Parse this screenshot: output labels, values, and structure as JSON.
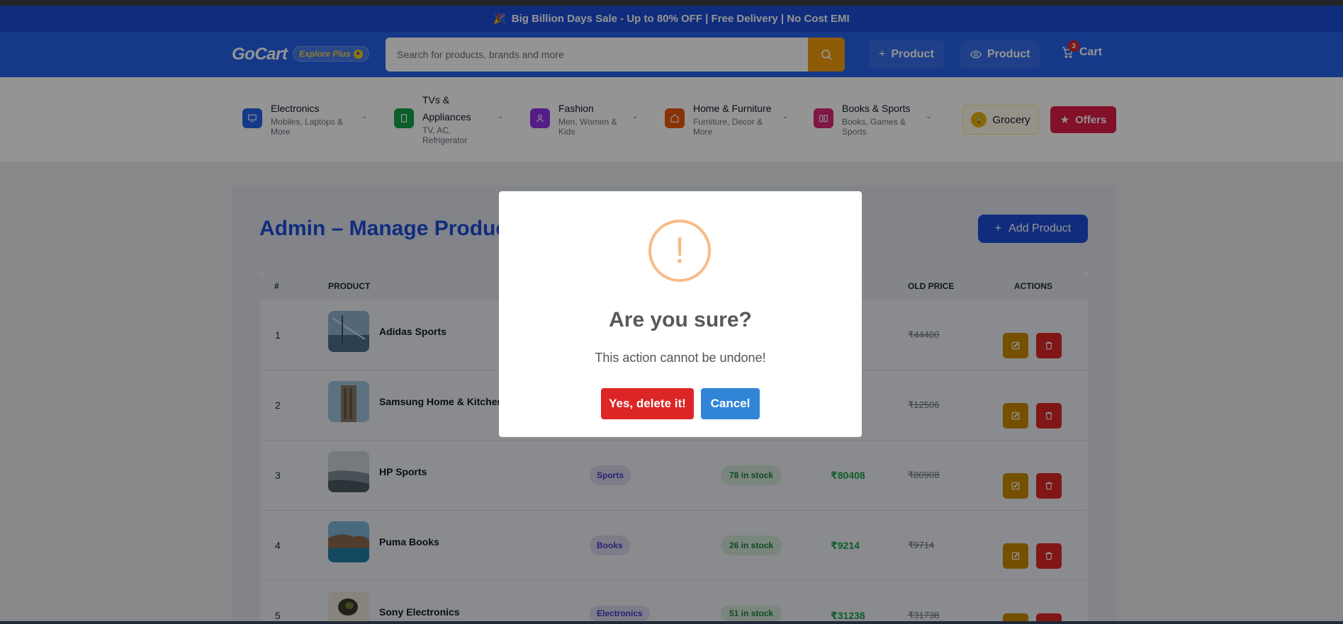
{
  "promo": {
    "icon": "party-popper-icon",
    "text": "Big Billion Days Sale - Up to 80% OFF | Free Delivery | No Cost EMI"
  },
  "header": {
    "logo": "GoCart",
    "explore": "Explore Plus",
    "search_placeholder": "Search for products, brands and more",
    "btn_add_product": "Product",
    "btn_view_product": "Product",
    "cart_label": "Cart",
    "cart_count": "3"
  },
  "categories": [
    {
      "name": "Electronics",
      "sub": [
        "Mobiles, Laptops &",
        "More"
      ],
      "icon": "monitor-icon",
      "color": "#2563eb"
    },
    {
      "name_lines": [
        "TVs &",
        "Appliances"
      ],
      "sub": [
        "TV, AC,",
        "Refrigerator"
      ],
      "icon": "tv-icon",
      "color": "#16a34a"
    },
    {
      "name": "Fashion",
      "sub": [
        "Men, Women &",
        "Kids"
      ],
      "icon": "user-icon",
      "color": "#9333ea"
    },
    {
      "name": "Home & Furniture",
      "sub": [
        "Furniture, Decor &",
        "More"
      ],
      "icon": "home-icon",
      "color": "#ea580c"
    },
    {
      "name": "Books & Sports",
      "sub": [
        "Books, Games &",
        "Sports"
      ],
      "icon": "book-icon",
      "color": "#db2777"
    }
  ],
  "grocery": "Grocery",
  "offers": "Offers",
  "page": {
    "title": "Admin – Manage Products",
    "add_button": "Add Product",
    "columns": {
      "num": "#",
      "product": "PRODUCT",
      "old_price": "OLD PRICE",
      "actions": "ACTIONS"
    }
  },
  "rows": [
    {
      "num": "1",
      "name": "Adidas Sports",
      "category": "",
      "stock": "",
      "price": "",
      "old_price": "₹44400"
    },
    {
      "num": "2",
      "name": "Samsung Home & Kitchen",
      "category": "",
      "stock": "",
      "price": "",
      "old_price": "₹12506"
    },
    {
      "num": "3",
      "name": "HP Sports",
      "category": "Sports",
      "stock": "78 in stock",
      "price": "₹80408",
      "old_price": "₹80908"
    },
    {
      "num": "4",
      "name": "Puma Books",
      "category": "Books",
      "stock": "26 in stock",
      "price": "₹9214",
      "old_price": "₹9714"
    },
    {
      "num": "5",
      "name": "Sony Electronics",
      "category": "Electronics",
      "stock": "51 in stock",
      "price": "₹31238",
      "old_price": "₹31738"
    }
  ],
  "modal": {
    "icon": "exclamation-icon",
    "title": "Are you sure?",
    "text": "This action cannot be undone!",
    "confirm": "Yes, delete it!",
    "cancel": "Cancel"
  },
  "colors": {
    "brand": "#2563eb",
    "promo": "#1d4fd7",
    "confirm": "#dc2626",
    "cancel": "#3085d6",
    "warning": "#f8bb86"
  }
}
